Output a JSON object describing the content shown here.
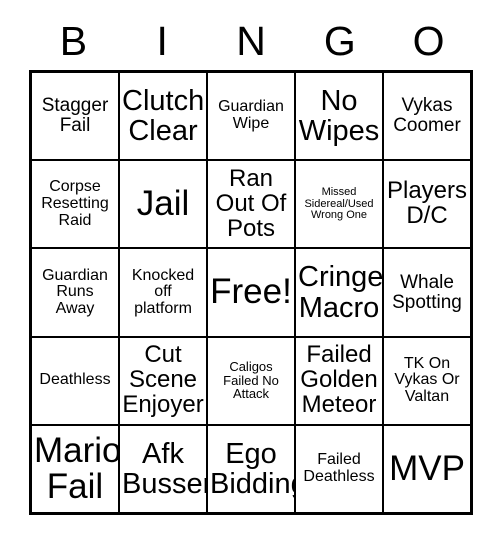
{
  "card": {
    "header_letters": [
      "B",
      "I",
      "N",
      "G",
      "O"
    ],
    "rows": [
      [
        {
          "text": "Stagger\nFail",
          "size": "md"
        },
        {
          "text": "Clutch\nClear",
          "size": "xl"
        },
        {
          "text": "Guardian\nWipe",
          "size": "sm"
        },
        {
          "text": "No\nWipes",
          "size": "xl"
        },
        {
          "text": "Vykas\nCoomer",
          "size": "md"
        }
      ],
      [
        {
          "text": "Corpse\nResetting\nRaid",
          "size": "sm"
        },
        {
          "text": "Jail",
          "size": "xxl"
        },
        {
          "text": "Ran\nOut Of\nPots",
          "size": "lg"
        },
        {
          "text": "Missed\nSidereal/Used\nWrong One",
          "size": "xxs"
        },
        {
          "text": "Players\nD/C",
          "size": "lg"
        }
      ],
      [
        {
          "text": "Guardian\nRuns\nAway",
          "size": "sm"
        },
        {
          "text": "Knocked\noff\nplatform",
          "size": "sm"
        },
        {
          "text": "Free!",
          "size": "xxl"
        },
        {
          "text": "Cringe\nMacro",
          "size": "xl"
        },
        {
          "text": "Whale\nSpotting",
          "size": "md"
        }
      ],
      [
        {
          "text": "Deathless",
          "size": "sm"
        },
        {
          "text": "Cut\nScene\nEnjoyer",
          "size": "lg"
        },
        {
          "text": "Caligos\nFailed No\nAttack",
          "size": "xs"
        },
        {
          "text": "Failed\nGolden\nMeteor",
          "size": "lg"
        },
        {
          "text": "TK On\nVykas Or\nValtan",
          "size": "sm"
        }
      ],
      [
        {
          "text": "Mario\nFail",
          "size": "xxl"
        },
        {
          "text": "Afk\nBusser",
          "size": "xl"
        },
        {
          "text": "Ego\nBidding",
          "size": "xl"
        },
        {
          "text": "Failed\nDeathless",
          "size": "sm"
        },
        {
          "text": "MVP",
          "size": "xxl"
        }
      ]
    ]
  },
  "colors": {
    "background": "#ffffff",
    "ink": "#000000",
    "grid_line": "#000000"
  }
}
